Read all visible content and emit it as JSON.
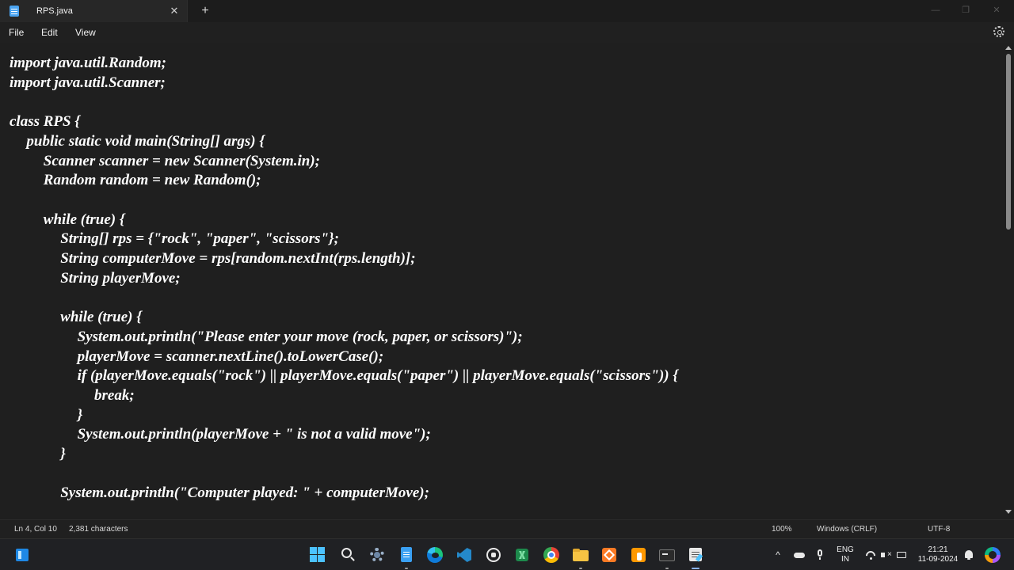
{
  "window": {
    "tab_title": "RPS.java",
    "tab_close": "✕",
    "new_tab": "+",
    "minimize": "—",
    "maximize": "❐",
    "close": "✕"
  },
  "menu": {
    "file": "File",
    "edit": "Edit",
    "view": "View"
  },
  "editor": {
    "lines": [
      "import java.util.Random;",
      "import java.util.Scanner;",
      "",
      "class RPS {",
      "  public static void main(String[] args) {",
      "    Scanner scanner = new Scanner(System.in);",
      "    Random random = new Random();",
      "",
      "    while (true) {",
      "      String[] rps = {\"rock\", \"paper\", \"scissors\"};",
      "      String computerMove = rps[random.nextInt(rps.length)];",
      "      String playerMove;",
      "",
      "      while (true) {",
      "        System.out.println(\"Please enter your move (rock, paper, or scissors)\");",
      "        playerMove = scanner.nextLine().toLowerCase();",
      "        if (playerMove.equals(\"rock\") || playerMove.equals(\"paper\") || playerMove.equals(\"scissors\")) {",
      "          break;",
      "        }",
      "        System.out.println(playerMove + \" is not a valid move\");",
      "      }",
      "",
      "      System.out.println(\"Computer played: \" + computerMove);"
    ]
  },
  "status": {
    "position": "Ln 4, Col 10",
    "characters": "2,381 characters",
    "zoom": "100%",
    "line_ending": "Windows (CRLF)",
    "encoding": "UTF-8"
  },
  "taskbar": {
    "icons": [
      "start-icon",
      "search-icon",
      "settings-icon",
      "notepad-icon",
      "edge-icon",
      "vscode-icon",
      "whatsapp-icon",
      "excel-icon",
      "chrome-icon",
      "file-explorer-icon",
      "xampp-icon",
      "sublime-icon",
      "terminal-icon",
      "notepad-active-icon"
    ],
    "tray": {
      "chevron": "^",
      "lang_top": "ENG",
      "lang_bottom": "IN",
      "time": "21:21",
      "date": "11-09-2024"
    }
  },
  "colors": {
    "editor_bg": "#1f1f1f",
    "text": "#ffffff",
    "accent": "#4cc2ff"
  }
}
